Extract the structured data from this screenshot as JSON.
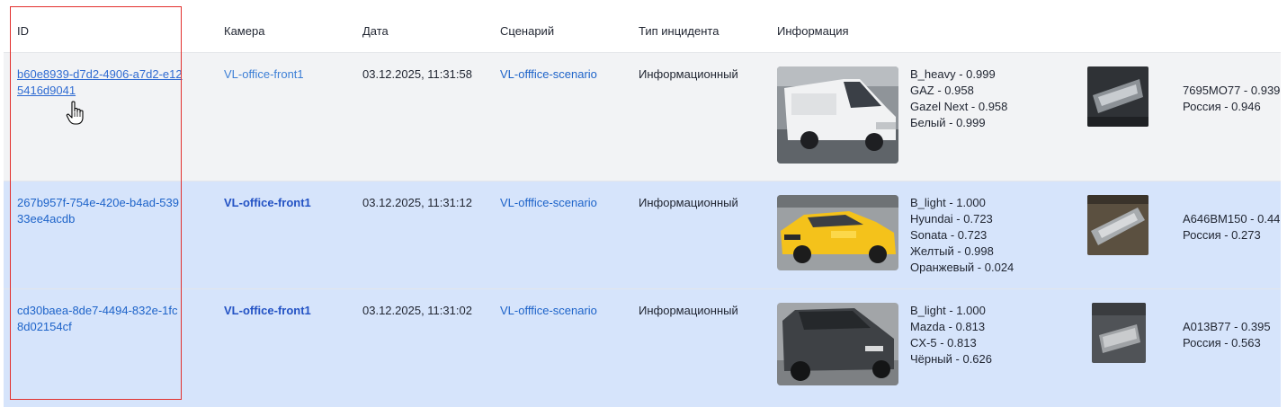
{
  "header": {
    "id": "ID",
    "camera": "Камера",
    "date": "Дата",
    "scenario": "Сценарий",
    "incident_type": "Тип инцидента",
    "info": "Информация"
  },
  "rows": [
    {
      "id": "b60e8939-d7d2-4906-a7d2-e125416d9041",
      "camera": "VL-office-front1",
      "date": "03.12.2025, 11:31:58",
      "scenario": "VL-offfice-scenario",
      "incident_type": "Информационный",
      "vehicle_image": "white-van-photo",
      "attributes": [
        "B_heavy - 0.999",
        "GAZ - 0.958",
        "Gazel Next - 0.958",
        "Белый - 0.999"
      ],
      "plate_image": "plate-crop-photo",
      "plate_info": [
        "7695MO77 - 0.939",
        "Россия - 0.946"
      ]
    },
    {
      "id": "267b957f-754e-420e-b4ad-53933ee4acdb",
      "camera": "VL-office-front1",
      "date": "03.12.2025, 11:31:12",
      "scenario": "VL-offfice-scenario",
      "incident_type": "Информационный",
      "vehicle_image": "yellow-taxi-photo",
      "attributes": [
        "B_light - 1.000",
        "Hyundai - 0.723",
        "Sonata - 0.723",
        "Желтый - 0.998",
        "Оранжевый - 0.024"
      ],
      "plate_image": "plate-crop-photo",
      "plate_info": [
        "A646BM150 - 0.44",
        "Россия - 0.273"
      ]
    },
    {
      "id": "cd30baea-8de7-4494-832e-1fc8d02154cf",
      "camera": "VL-office-front1",
      "date": "03.12.2025, 11:31:02",
      "scenario": "VL-offfice-scenario",
      "incident_type": "Информационный",
      "vehicle_image": "dark-suv-photo",
      "attributes": [
        "B_light - 1.000",
        "Mazda - 0.813",
        "CX-5 - 0.813",
        "Чёрный - 0.626"
      ],
      "plate_image": "plate-crop-photo",
      "plate_info": [
        "A013B77 - 0.395",
        "Россия - 0.563"
      ]
    }
  ],
  "colors": {
    "link": "#1d63c9",
    "selected_row": "#d6e4fb",
    "highlight_border": "#e2302d"
  }
}
